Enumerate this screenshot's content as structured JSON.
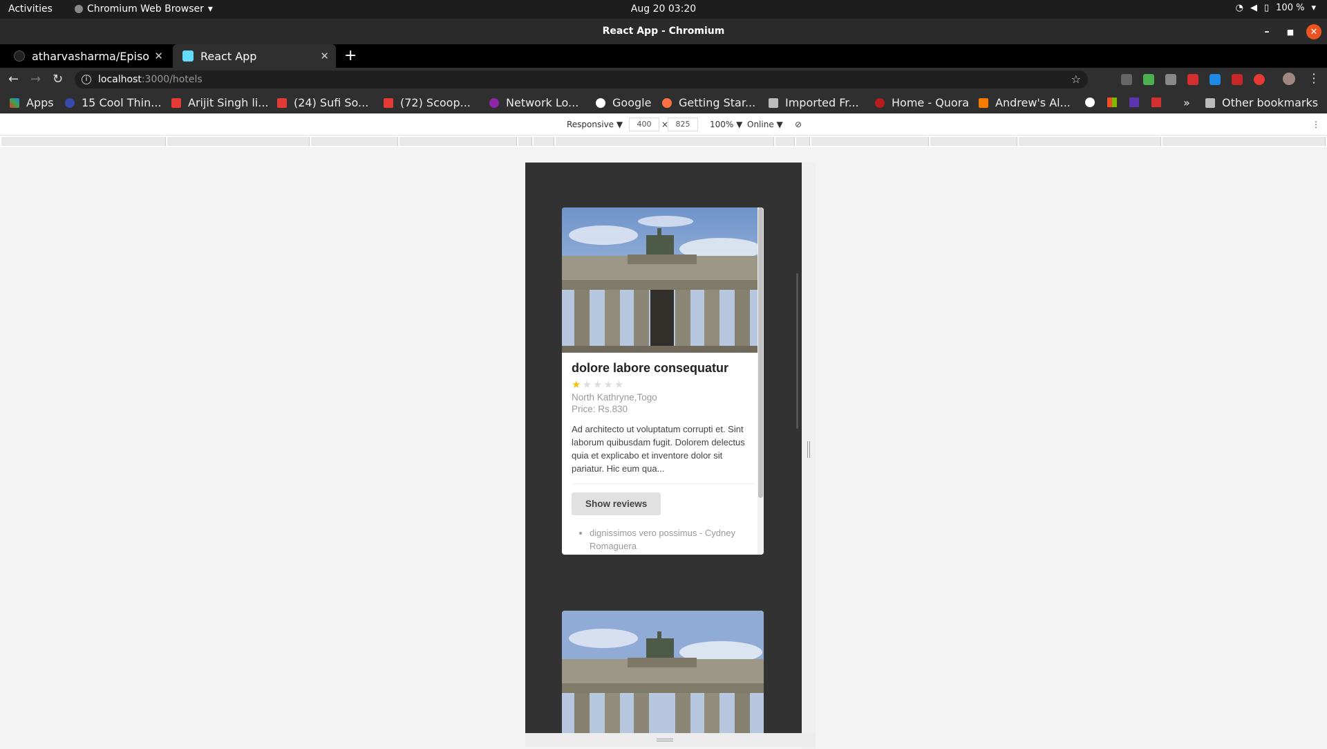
{
  "topbar": {
    "activities": "Activities",
    "app": "Chromium Web Browser",
    "clock": "Aug 20  03:20",
    "battery": "100 %"
  },
  "window": {
    "title": "React App - Chromium"
  },
  "tabs": [
    {
      "label": "atharvasharma/Episo"
    },
    {
      "label": "React App"
    }
  ],
  "url": {
    "host": "localhost",
    "path": ":3000/hotels"
  },
  "bookmarks": [
    {
      "label": "Apps"
    },
    {
      "label": "15 Cool Thin..."
    },
    {
      "label": "Arijit Singh li..."
    },
    {
      "label": "(24) Sufi So..."
    },
    {
      "label": "(72) Scoop..."
    },
    {
      "label": "Network Lo..."
    },
    {
      "label": "Google"
    },
    {
      "label": "Getting Star..."
    },
    {
      "label": "Imported Fr..."
    },
    {
      "label": "Home - Quora"
    },
    {
      "label": "Andrew's Al..."
    },
    {
      "label": "»"
    },
    {
      "label": "Other bookmarks"
    }
  ],
  "devtools": {
    "device": "Responsive ▼",
    "width": "400",
    "height": "825",
    "zoom": "100% ▼",
    "network": "Online ▼"
  },
  "hotels": [
    {
      "name": "dolore labore consequatur",
      "rating": 1,
      "location": "North Kathryne,Togo",
      "price": "Price: Rs.830",
      "description": "Ad architecto ut voluptatum corrupti et. Sint laborum quibusdam fugit. Dolorem delectus quia et explicabo et inventore dolor sit pariatur. Hic eum qua...",
      "button": "Show reviews",
      "review": "dignissimos vero possimus - Cydney Romaguera"
    }
  ],
  "colors": {
    "accent_star": "#f1c40f",
    "device_bg": "#323232"
  }
}
